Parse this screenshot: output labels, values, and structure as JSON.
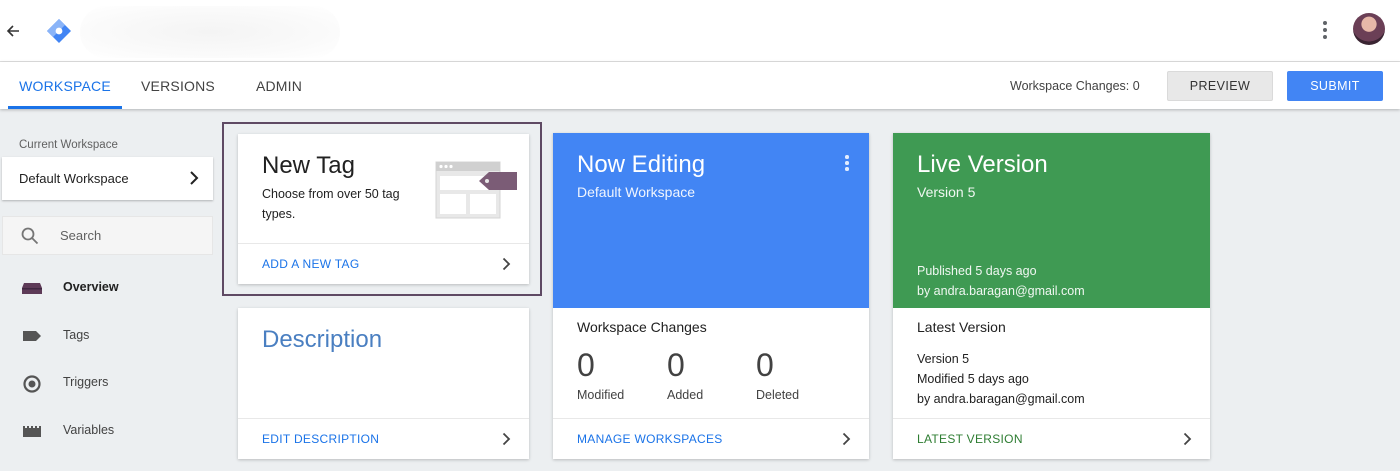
{
  "header": {
    "back_icon": "arrow-back-icon",
    "logo_icon": "tag-manager-logo",
    "menu_icon": "more-vert-icon",
    "avatar_icon": "user-avatar"
  },
  "tabs": {
    "items": [
      {
        "label": "WORKSPACE",
        "active": true
      },
      {
        "label": "VERSIONS",
        "active": false
      },
      {
        "label": "ADMIN",
        "active": false
      }
    ],
    "workspace_changes": "Workspace Changes: 0",
    "preview_label": "PREVIEW",
    "submit_label": "SUBMIT"
  },
  "sidebar": {
    "current_workspace_label": "Current Workspace",
    "current_workspace_value": "Default Workspace",
    "search_placeholder": "Search",
    "nav": [
      {
        "label": "Overview",
        "icon": "overview-icon",
        "active": true
      },
      {
        "label": "Tags",
        "icon": "tag-icon",
        "active": false
      },
      {
        "label": "Triggers",
        "icon": "trigger-icon",
        "active": false
      },
      {
        "label": "Variables",
        "icon": "variables-icon",
        "active": false
      }
    ]
  },
  "new_tag": {
    "title": "New Tag",
    "description": "Choose from over 50 tag types.",
    "link": "ADD A NEW TAG"
  },
  "description_card": {
    "title": "Description",
    "link": "EDIT DESCRIPTION"
  },
  "now_editing": {
    "title": "Now Editing",
    "subtitle": "Default Workspace",
    "color": "#4285f4",
    "changes_title": "Workspace Changes",
    "stats": [
      {
        "value": "0",
        "label": "Modified"
      },
      {
        "value": "0",
        "label": "Added"
      },
      {
        "value": "0",
        "label": "Deleted"
      }
    ],
    "link": "MANAGE WORKSPACES"
  },
  "live_version": {
    "title": "Live Version",
    "subtitle": "Version 5",
    "color": "#3f9a53",
    "published": "Published 5 days ago",
    "published_by": "by andra.baragan@gmail.com",
    "latest_title": "Latest Version",
    "latest_version": "Version 5",
    "latest_modified": "Modified 5 days ago",
    "latest_by": "by andra.baragan@gmail.com",
    "link": "LATEST VERSION"
  },
  "colors": {
    "accent": "#1a73e8",
    "submit": "#4285f4",
    "background": "#eceff1"
  }
}
